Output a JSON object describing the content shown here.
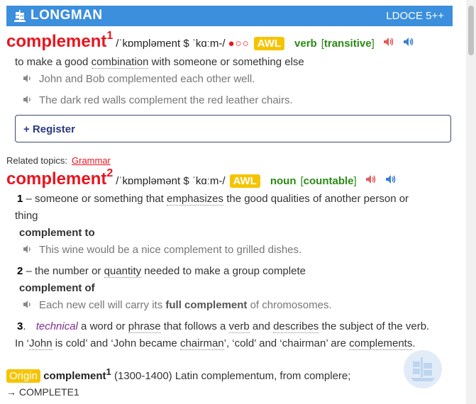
{
  "header": {
    "brand": "LONGMAN",
    "edition": "LDOCE 5++"
  },
  "entry1": {
    "headword": "complement",
    "homnum": "1",
    "pron": "/ˈkɒmpləment $ ˈkɑːm-/",
    "freq": "●○○",
    "awl": "AWL",
    "pos": "verb",
    "gram_open": "[",
    "gram": "transitive",
    "gram_close": "]",
    "definition": {
      "p1": "to make a good ",
      "link1": "combination",
      "p2": " with someone or something else"
    },
    "examples": [
      "John and Bob complemented each other well.",
      "The dark red walls complement the red leather chairs."
    ]
  },
  "register": {
    "label": "+ Register"
  },
  "related": {
    "label": "Related topics:",
    "topic": "Grammar"
  },
  "entry2": {
    "headword": "complement",
    "homnum": "2",
    "pron": "/ˈkɒmpləmənt $ ˈkɑːm-/",
    "awl": "AWL",
    "pos": "noun",
    "gram_open": "[",
    "gram": "countable",
    "gram_close": "]",
    "sense1": {
      "num": "1",
      "dash": "–",
      "p1": "someone or something that ",
      "link1": "emphasizes",
      "p2": " the good qualities of another person or",
      "line2": "thing",
      "colloc": "complement to",
      "example": "This wine would be a nice complement to grilled dishes."
    },
    "sense2": {
      "num": "2",
      "dash": "–",
      "p1": "the number or ",
      "link1": "quantity",
      "p2": " needed to make a group complete",
      "colloc": "complement of",
      "ex_p1": "Each new cell will carry its ",
      "ex_bold": "full complement",
      "ex_p2": " of chromosomes."
    },
    "sense3": {
      "num": "3",
      "dot": ".",
      "field": "technical",
      "p1": " a word or ",
      "link1": "phrase",
      "p2": " that follows a ",
      "link2": "verb",
      "p3": " and ",
      "link3": "describes",
      "p4": " the subject of the verb.",
      "l2_p1": "In ‘",
      "l2_link1": "John",
      "l2_p2": " is cold’ and ‘John became ",
      "l2_link2": "chairman",
      "l2_p3": "’, ‘cold’ and ‘chairman’ are ",
      "l2_link3": "complements",
      "l2_p4": "."
    }
  },
  "origin": {
    "badge": "Origin",
    "headword": "complement",
    "homnum": "1",
    "text": "(1300-1400) Latin complementum, from complere;",
    "xref": "→ COMPLETE1"
  },
  "colors": {
    "header_bg": "#3b8fdd",
    "headword": "#e8151f",
    "awl": "#f5c400",
    "pos": "#2a8a14",
    "technical": "#7a2e8c"
  },
  "icons": [
    "longman-ship-icon",
    "speaker-red-icon",
    "speaker-blue-icon",
    "speaker-example-icon"
  ]
}
